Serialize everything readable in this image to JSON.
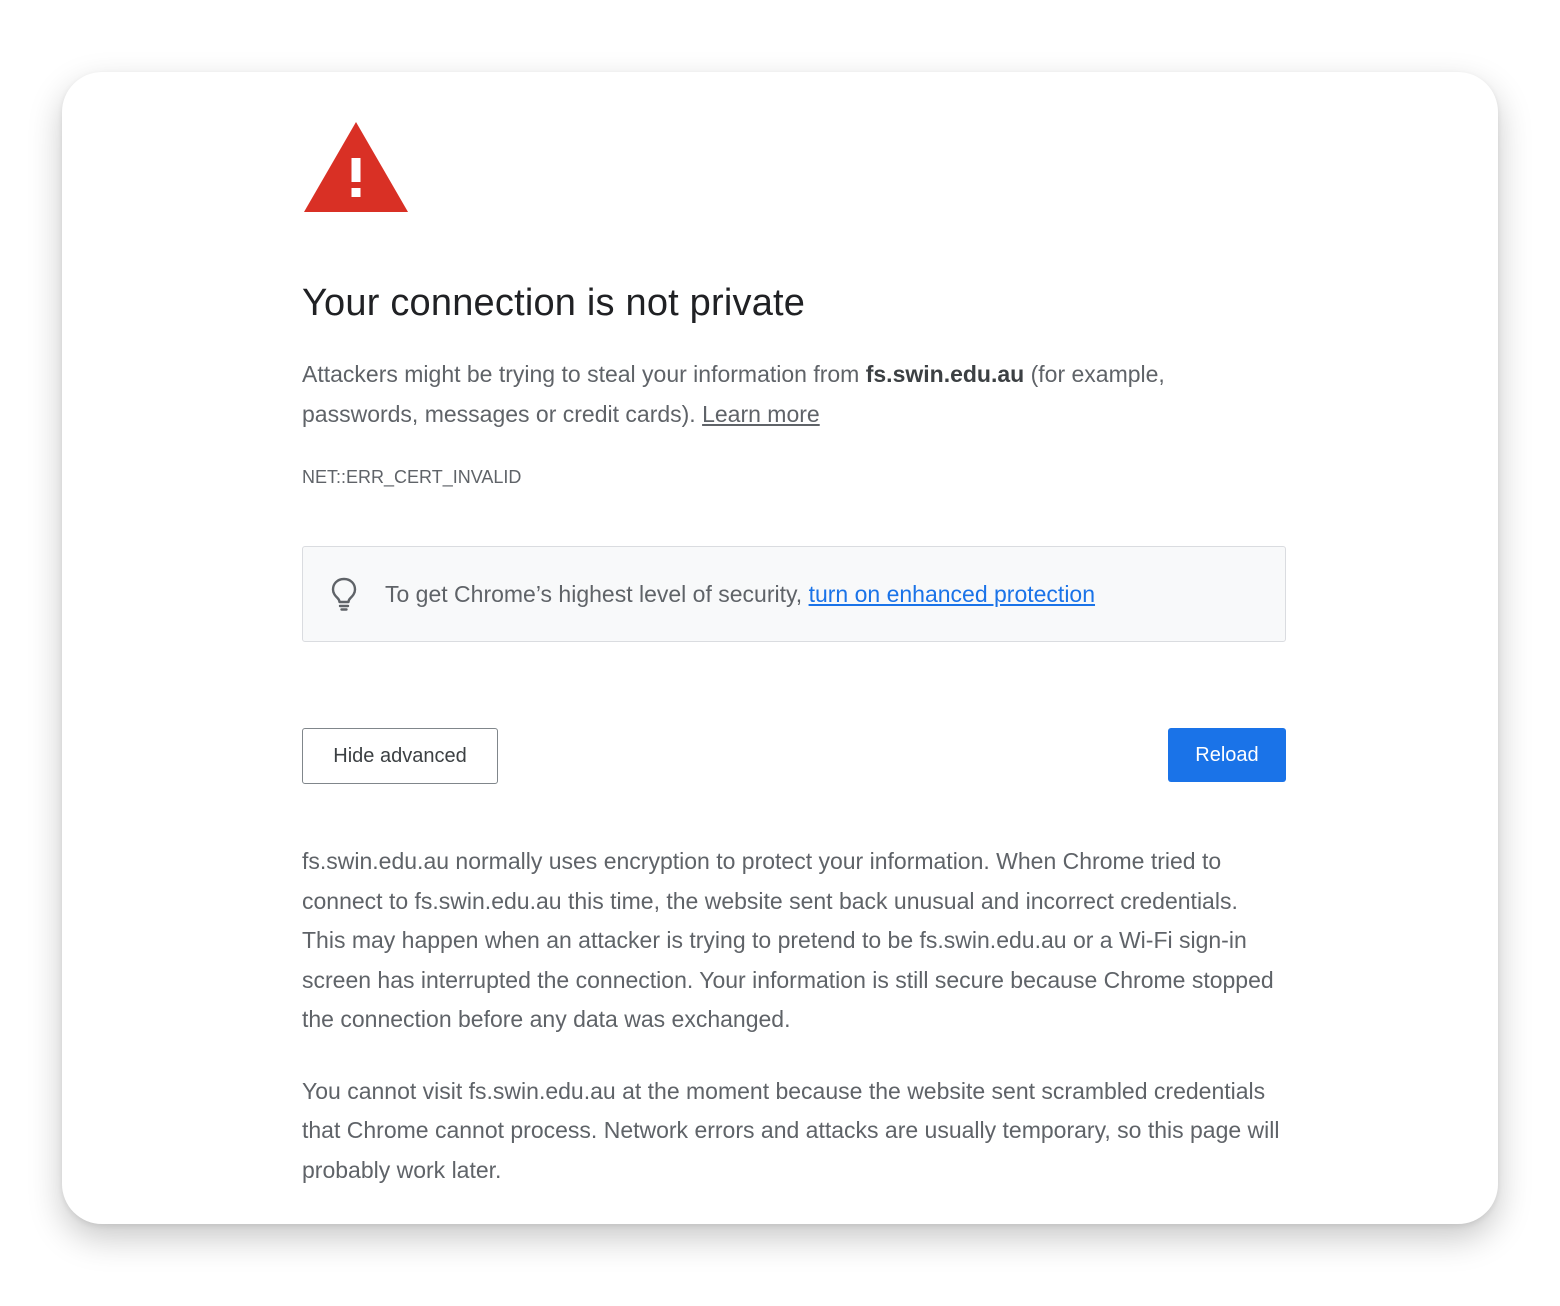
{
  "colors": {
    "warning_red": "#d93025",
    "link_blue": "#1a73e8",
    "reload_button": "#1a73e8",
    "text_primary": "#202124",
    "text_secondary": "#5f6368"
  },
  "icons": {
    "warning": "warning-triangle-icon",
    "bulb": "lightbulb-icon"
  },
  "heading": "Your connection is not private",
  "intro": {
    "text_before": "Attackers might be trying to steal your information from ",
    "domain": "fs.swin.edu.au",
    "text_after": " (for example, passwords, messages or credit cards). ",
    "learn_more": "Learn more"
  },
  "error_code": "NET::ERR_CERT_INVALID",
  "security_tip": {
    "text": "To get Chrome’s highest level of security, ",
    "link": "turn on enhanced protection"
  },
  "buttons": {
    "hide_advanced": "Hide advanced",
    "reload": "Reload"
  },
  "details": [
    "fs.swin.edu.au normally uses encryption to protect your information. When Chrome tried to connect to fs.swin.edu.au this time, the website sent back unusual and incorrect credentials. This may happen when an attacker is trying to pretend to be fs.swin.edu.au or a Wi-Fi sign-in screen has interrupted the connection. Your information is still secure because Chrome stopped the connection before any data was exchanged.",
    "You cannot visit fs.swin.edu.au at the moment because the website sent scrambled credentials that Chrome cannot process. Network errors and attacks are usually temporary, so this page will probably work later."
  ]
}
